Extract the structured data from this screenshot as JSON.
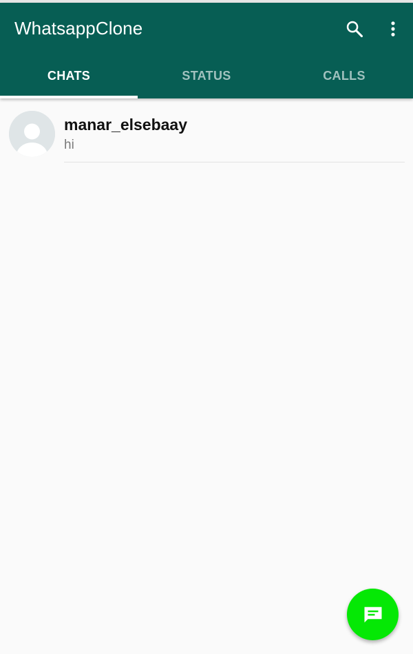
{
  "app": {
    "title": "WhatsappClone"
  },
  "toolbar": {
    "search_icon": "search-icon",
    "menu_icon": "more-vert-icon"
  },
  "tabs": [
    {
      "label": "CHATS",
      "active": true
    },
    {
      "label": "STATUS",
      "active": false
    },
    {
      "label": "CALLS",
      "active": false
    }
  ],
  "chats": [
    {
      "name": "manar_elsebaay",
      "last_message": "hi",
      "avatar_icon": "default-avatar-icon"
    }
  ],
  "fab": {
    "icon": "new-chat-icon"
  },
  "colors": {
    "primary": "#075e54",
    "fab": "#05e805",
    "background": "#fafafa",
    "avatar_bg": "#dfe5e7"
  }
}
